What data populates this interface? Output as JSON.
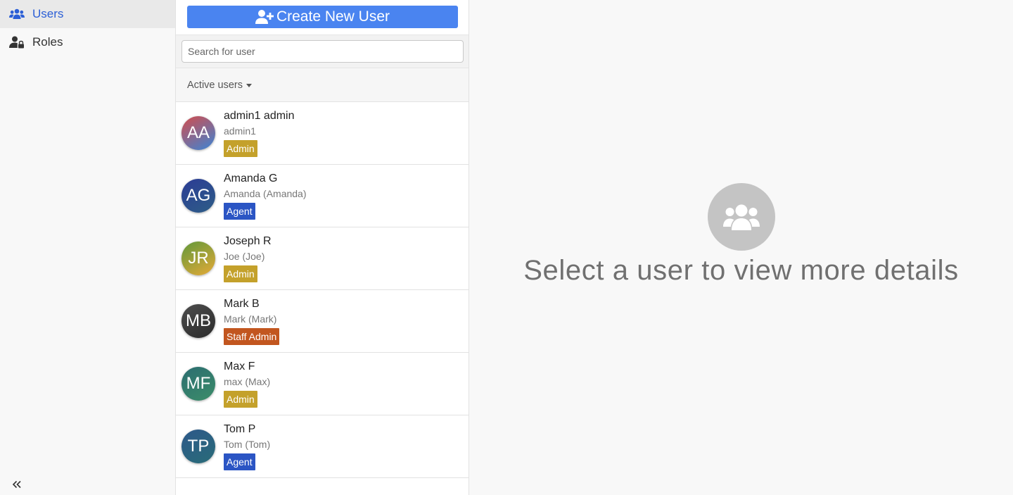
{
  "sidebar": {
    "items": [
      {
        "label": "Users",
        "icon": "users-icon",
        "active": true
      },
      {
        "label": "Roles",
        "icon": "user-lock-icon",
        "active": false
      }
    ],
    "collapse_icon": "double-chevron-left-icon"
  },
  "list": {
    "create_button_label": "Create New User",
    "search_placeholder": "Search for user",
    "filter_label": "Active users",
    "users": [
      {
        "initials": "AA",
        "name": "admin1 admin",
        "login": "admin1",
        "role": "Admin"
      },
      {
        "initials": "AG",
        "name": "Amanda G",
        "login": "Amanda (Amanda)",
        "role": "Agent"
      },
      {
        "initials": "JR",
        "name": "Joseph R",
        "login": "Joe (Joe)",
        "role": "Admin"
      },
      {
        "initials": "MB",
        "name": "Mark B",
        "login": "Mark (Mark)",
        "role": "Staff Admin"
      },
      {
        "initials": "MF",
        "name": "Max F",
        "login": "max (Max)",
        "role": "Admin"
      },
      {
        "initials": "TP",
        "name": "Tom P",
        "login": "Tom (Tom)",
        "role": "Agent"
      }
    ]
  },
  "detail": {
    "empty_message": "Select a user to view more details"
  },
  "colors": {
    "accent": "#4a84f0",
    "nav_active": "#2c5fd6",
    "role_admin": "#c4a12b",
    "role_agent": "#2b55c4",
    "role_staff_admin": "#c2561f",
    "avatar_AA": [
      "#c4525a",
      "#4a7fc8"
    ],
    "avatar_AG": [
      "#2c3f94",
      "#2d5a88"
    ],
    "avatar_JR": [
      "#6e9a3a",
      "#d8a838"
    ],
    "avatar_MB": [
      "#444444",
      "#303030"
    ],
    "avatar_MF": [
      "#2d7070",
      "#3a8a6a"
    ],
    "avatar_TP": [
      "#2c5a88",
      "#2a6a7a"
    ]
  }
}
